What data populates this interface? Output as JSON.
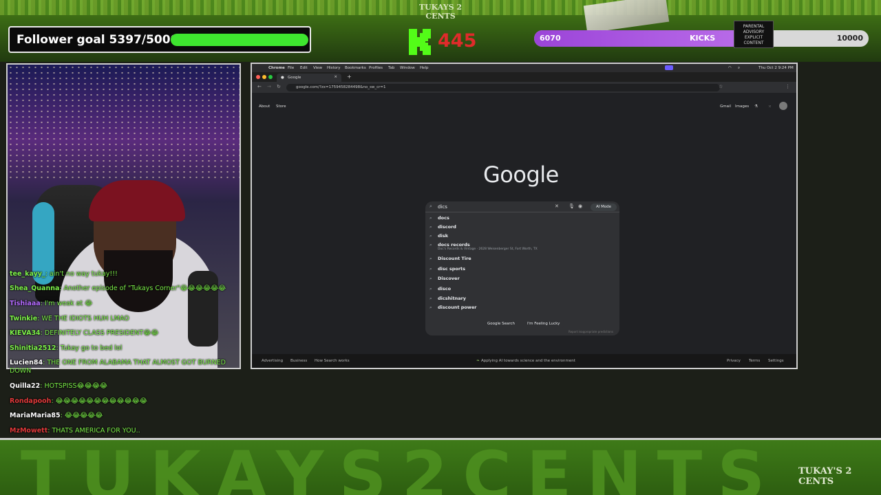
{
  "overlay": {
    "brand_top": "TUKAYS 2 CENTS",
    "brand_bottom": "TUKAY'S 2 CENTS",
    "bottom_banner_text": "TUKAYS2CENTS",
    "follower_goal": {
      "label": "Follower goal 5397/5000",
      "progress": 1.0
    },
    "kick_count": "445",
    "kicks_bar": {
      "left_value": "6070",
      "label": "KICKS",
      "right_value": "10000",
      "progress": 0.607
    },
    "parental_text": "PARENTAL ADVISORY EXPLICIT CONTENT"
  },
  "chat": [
    {
      "name": "tee_kayy_",
      "name_color": "#7ef24a",
      "msg": ": ain't no way tukay!!!"
    },
    {
      "name": "Shea_Quanna",
      "name_color": "#7ef24a",
      "msg": ": Another episode of \"Tukays Corner\"😂😂😂😂😂😂"
    },
    {
      "name": "Tishiaaa",
      "name_color": "#b46bff",
      "msg": ": I'm weak at 😂"
    },
    {
      "name": "Twinkie",
      "name_color": "#7ef24a",
      "msg": ": WE THE IDIOTS HUH LMAO"
    },
    {
      "name": "KIEVA34",
      "name_color": "#7ef24a",
      "msg": ": DEFINITELY CLASS PRESIDENT😂😂"
    },
    {
      "name": "Shinitia2512",
      "name_color": "#7ef24a",
      "msg": ": Tukay go to bed lol"
    },
    {
      "name": "Lucien84",
      "name_color": "#ffffff",
      "msg": ": THE ONE FROM ALABAMA THAT ALMOST GOT BURNED"
    },
    {
      "name": "",
      "name_color": "#ffffff",
      "msg": "DOWN"
    },
    {
      "name": "Quilla22",
      "name_color": "#ffffff",
      "msg": ": HOTSPISS😂😂😂😂"
    },
    {
      "name": "Rondapooh",
      "name_color": "#e03a3a",
      "msg": ": 😂😂😂😂😂😂😂😂😂😂😂😂"
    },
    {
      "name": "MariaMaria85",
      "name_color": "#ffffff",
      "msg": ": 😂😂😂😂😂"
    },
    {
      "name": "MzMowett",
      "name_color": "#e03a3a",
      "msg": ": THATS AMERICA FOR YOU.."
    }
  ],
  "browser": {
    "menubar": [
      "Chrome",
      "File",
      "Edit",
      "View",
      "History",
      "Bookmarks",
      "Profiles",
      "Tab",
      "Window",
      "Help"
    ],
    "clock": "Thu Oct 2  9:24 PM",
    "tab_title": "Google",
    "url": "google.com/?zx=1759458284498&no_sw_cr=1",
    "top_left_links": [
      "About",
      "Store"
    ],
    "top_right_links": [
      "Gmail",
      "Images"
    ],
    "logo": "Google",
    "query": "dics",
    "ai_mode": "AI Mode",
    "suggestions": [
      {
        "text": "docs",
        "sub": ""
      },
      {
        "text": "discord",
        "sub": ""
      },
      {
        "text": "disk",
        "sub": ""
      },
      {
        "text": "docs records",
        "sub": "Doc's Records & Vintage · 2628 Weisenberger St, Fort Worth, TX"
      },
      {
        "text": "Discount Tire",
        "sub": ""
      },
      {
        "text": "disc sports",
        "sub": ""
      },
      {
        "text": "Discover",
        "sub": ""
      },
      {
        "text": "disco",
        "sub": ""
      },
      {
        "text": "dicshitnary",
        "sub": ""
      },
      {
        "text": "discount power",
        "sub": ""
      }
    ],
    "search_button": "Google Search",
    "lucky_button": "I'm Feeling Lucky",
    "report_text": "Report inappropriate predictions",
    "footer_left": [
      "Advertising",
      "Business",
      "How Search works"
    ],
    "footer_center": "Applying AI towards science and the environment",
    "footer_right": [
      "Privacy",
      "Terms",
      "Settings"
    ]
  }
}
